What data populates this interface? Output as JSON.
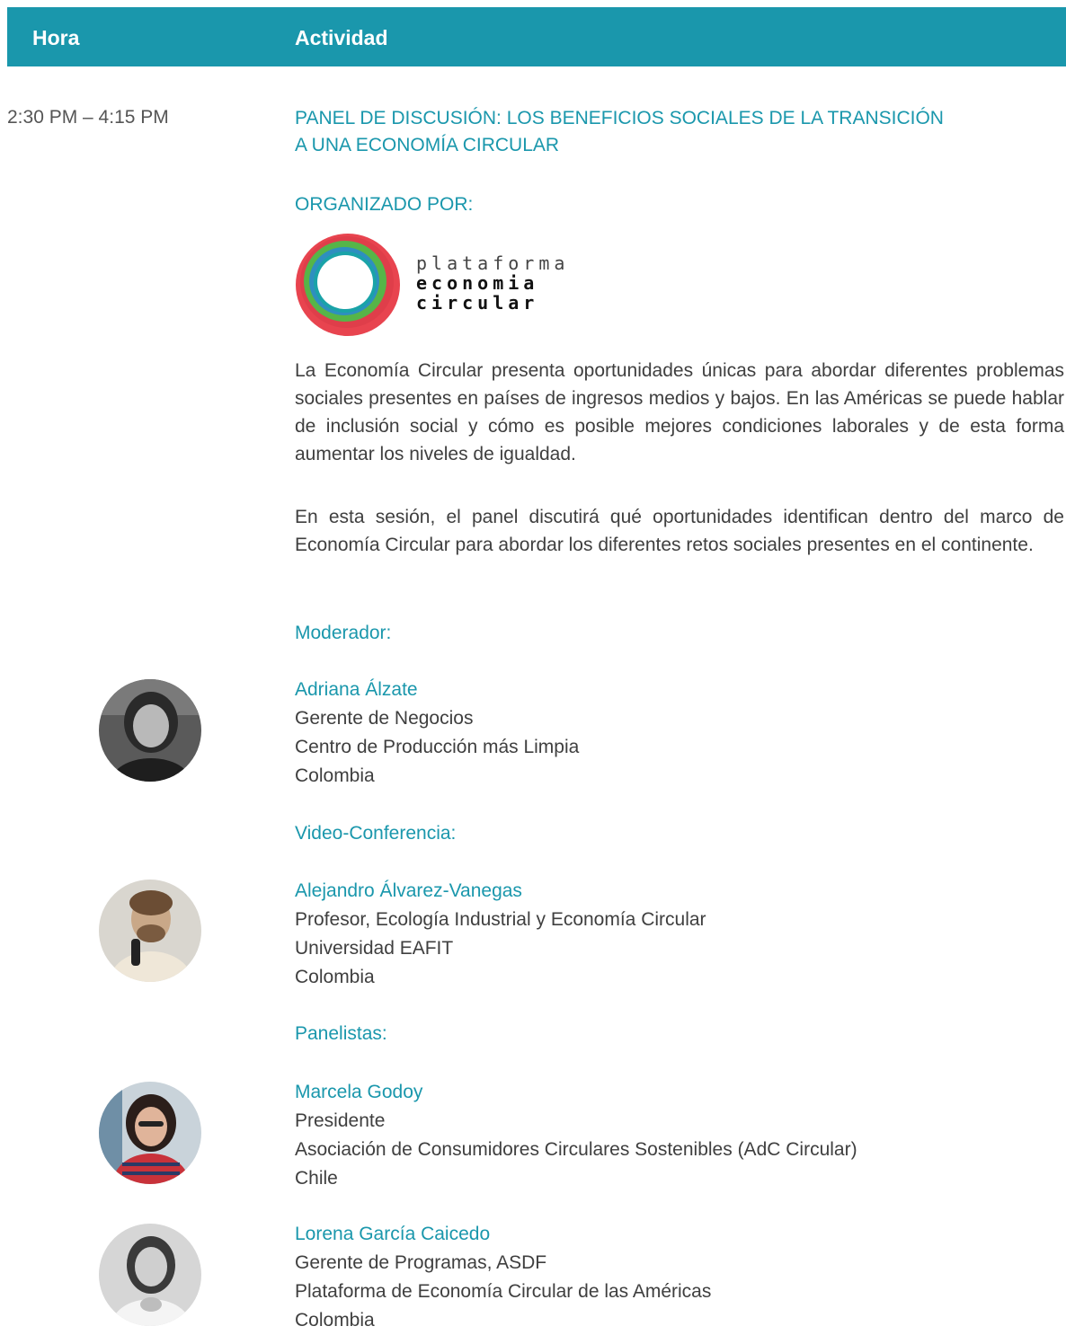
{
  "header": {
    "hora": "Hora",
    "actividad": "Actividad",
    "color": "#1a97ac"
  },
  "session": {
    "time": "2:30 PM – 4:15 PM",
    "title_line1": "PANEL DE DISCUSIÓN: LOS BENEFICIOS SOCIALES DE LA TRANSICIÓN",
    "title_line2": "A UNA ECONOMÍA CIRCULAR",
    "organized_by": "ORGANIZADO POR:",
    "logo": {
      "line1": "plataforma",
      "line2": "economia",
      "line3": "circular"
    },
    "paragraph1": "La Economía Circular presenta oportunidades únicas para abordar diferentes problemas sociales presentes en países de ingresos medios y bajos. En las Américas se puede hablar de inclusión social y cómo es posible mejores condiciones laborales y de esta forma aumentar los niveles de igualdad.",
    "paragraph2": "En esta sesión, el panel discutirá qué oportunidades identifican dentro del marco de Economía Circular para abordar los diferentes retos sociales presentes en el continente."
  },
  "moderator": {
    "label": "Moderador:",
    "name": "Adriana Álzate",
    "role": "Gerente de Negocios",
    "org": "Centro de Producción más Limpia",
    "country": "Colombia"
  },
  "video": {
    "label": "Video-Conferencia:",
    "name": "Alejandro Álvarez-Vanegas",
    "role": "Profesor, Ecología Industrial y Economía Circular",
    "org": "Universidad EAFIT",
    "country": "Colombia"
  },
  "panelists": {
    "label": "Panelistas:",
    "items": [
      {
        "name": "Marcela Godoy",
        "role": "Presidente",
        "org": "Asociación de Consumidores Circulares Sostenibles (AdC Circular)",
        "country": "Chile"
      },
      {
        "name": "Lorena García Caicedo",
        "role": "Gerente de Programas, ASDF",
        "org": "Plataforma de Economía Circular de las Américas",
        "country": "Colombia"
      }
    ]
  }
}
